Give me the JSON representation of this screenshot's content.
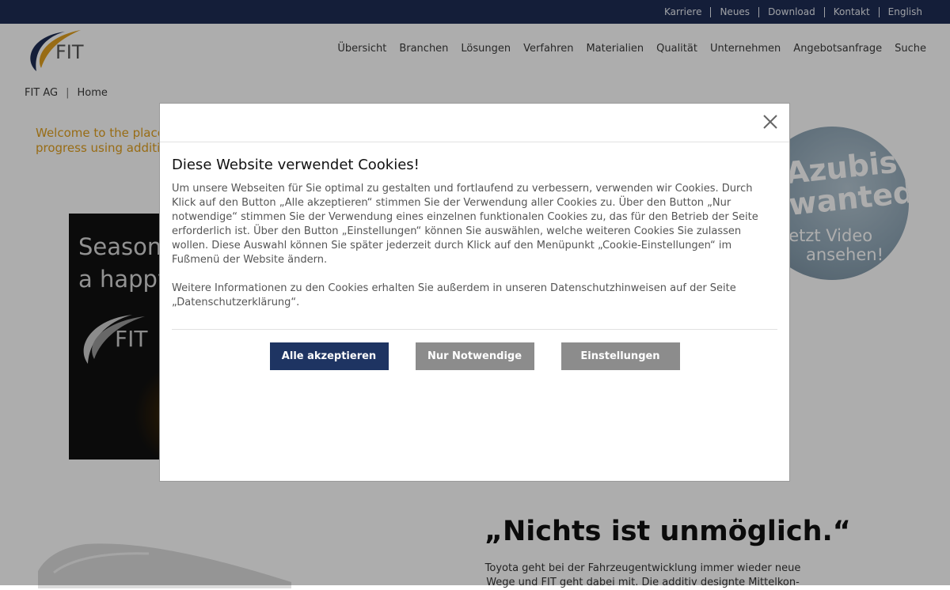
{
  "topbar": {
    "links": [
      "Karriere",
      "Neues",
      "Download",
      "Kontakt",
      "English"
    ]
  },
  "header": {
    "logo_text": "FIT",
    "nav": [
      "Übersicht",
      "Branchen",
      "Lösungen",
      "Verfahren",
      "Materialien",
      "Qualität",
      "Unternehmen",
      "Angebotsanfrage",
      "Suche"
    ]
  },
  "breadcrumb": {
    "items": [
      "FIT AG",
      "Home"
    ],
    "separator": "|"
  },
  "page": {
    "welcome_line1": "Welcome to the place",
    "welcome_line2": "progress using additiv",
    "season_line1": "Season",
    "season_line2": "a happy",
    "season_logo_text": "FIT",
    "azubi_graffiti_line1": "Azubis",
    "azubi_graffiti_line2": "wanted!",
    "azubi_cta_line1": "Jetzt Video",
    "azubi_cta_line2": "ansehen!",
    "quote_title": "„Nichts ist unmöglich.“",
    "quote_body": "Toyota geht bei der Fahrzeugentwicklung immer wieder neue Wege und FIT geht dabei mit. Die additiv designte Mittelkon-"
  },
  "cookie_modal": {
    "title": "Diese Website verwendet Cookies!",
    "paragraph1": "Um unsere Webseiten für Sie optimal zu gestalten und fortlaufend zu verbessern, verwenden wir Cookies. Durch Klick auf den Button „Alle akzeptieren“ stimmen Sie der Verwendung aller Cookies zu. Über den Button „Nur notwendige“ stimmen Sie der Verwendung eines einzelnen funktionalen Cookies zu, das für den Betrieb der Seite erforderlich ist. Über den Button „Einstellungen“ können Sie auswählen, welche weiteren Cookies Sie zulassen wollen. Diese Auswahl können Sie später jederzeit durch Klick auf den Menüpunkt „Cookie-Einstellungen“ im Fußmenü der Website ändern.",
    "paragraph2": "Weitere Informationen zu den Cookies erhalten Sie außerdem in unseren Datenschutzhinweisen auf der Seite „Datenschutzerklärung“.",
    "btn_accept_all": "Alle akzeptieren",
    "btn_necessary": "Nur Notwendige",
    "btn_settings": "Einstellungen",
    "close_icon": "close-icon"
  },
  "colors": {
    "topbar": "#1e2d54",
    "accent_orange": "#e0a020",
    "primary_button": "#1e3462",
    "secondary_button": "#8c8c8c"
  }
}
